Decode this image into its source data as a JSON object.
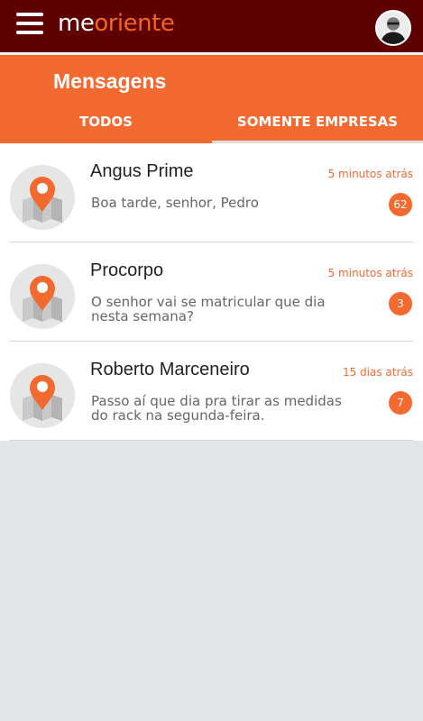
{
  "app": {
    "logo_me": "me",
    "logo_oriente": "oriente"
  },
  "header": {
    "title": "Mensagens",
    "tabs": [
      {
        "label": "TODOS",
        "active": true
      },
      {
        "label": "SOMENTE EMPRESAS",
        "active": false
      }
    ]
  },
  "colors": {
    "topbar": "#5e0000",
    "accent": "#f26a30"
  },
  "icons": {
    "menu": "hamburger-menu-icon",
    "avatar": "user-avatar",
    "item": "map-pin-icon"
  },
  "messages": [
    {
      "name": "Angus Prime",
      "time": "5 minutos atrás",
      "text": "Boa tarde, senhor, Pedro",
      "count": "62"
    },
    {
      "name": "Procorpo",
      "time": "5 minutos atrás",
      "text": "O senhor vai se matricular que dia nesta semana?",
      "count": "3"
    },
    {
      "name": "Roberto Marceneiro",
      "time": "15 dias atrás",
      "text": "Passo aí que dia pra tirar as medidas do rack na segunda-feira.",
      "count": "7"
    }
  ]
}
